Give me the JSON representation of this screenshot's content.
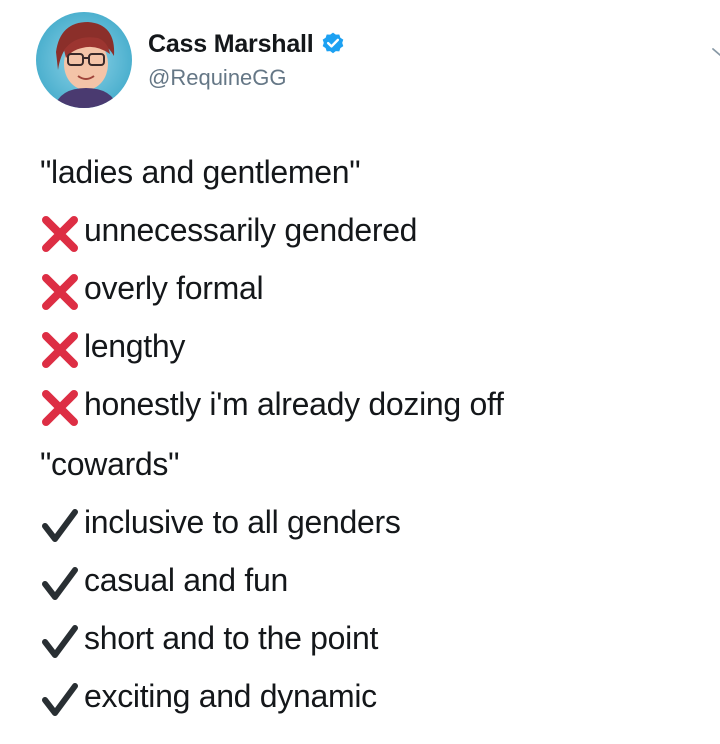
{
  "tweet": {
    "author": {
      "display_name": "Cass Marshall",
      "handle": "@RequineGG",
      "verified": true
    },
    "menu_icon": "chevron-down-icon",
    "accent_color": "#1da1f2",
    "cross_color": "#dd2e44",
    "check_color": "#292f33",
    "lines": [
      {
        "text": "\"ladies and gentlemen\"",
        "icon": null
      },
      {
        "text": "unnecessarily gendered",
        "icon": "cross-mark-icon"
      },
      {
        "text": "overly formal",
        "icon": "cross-mark-icon"
      },
      {
        "text": "lengthy",
        "icon": "cross-mark-icon"
      },
      {
        "text": "honestly i'm already dozing off",
        "icon": "cross-mark-icon"
      },
      {
        "text": "\"cowards\"",
        "icon": null
      },
      {
        "text": "inclusive to all genders",
        "icon": "check-mark-icon"
      },
      {
        "text": "casual and fun",
        "icon": "check-mark-icon"
      },
      {
        "text": "short and to the point",
        "icon": "check-mark-icon"
      },
      {
        "text": "exciting and dynamic",
        "icon": "check-mark-icon"
      }
    ]
  }
}
